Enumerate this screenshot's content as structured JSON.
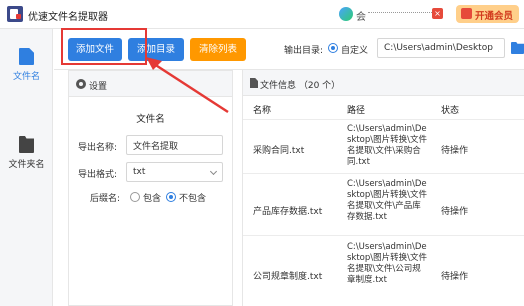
{
  "app": {
    "title": "优速文件名提取器"
  },
  "header": {
    "user_name": "会",
    "badge_text": "×",
    "vip_label": "开通会员"
  },
  "nav": {
    "items": [
      {
        "label": "文件名"
      },
      {
        "label": "文件夹名"
      }
    ]
  },
  "toolbar": {
    "add_file_label": "添加文件",
    "add_dir_label": "添加目录",
    "clear_label": "清除列表",
    "output_label": "输出目录:",
    "custom_label": "自定义",
    "output_path": "C:\\Users\\admin\\Desktop"
  },
  "settings": {
    "title": "设置",
    "section_title": "文件名",
    "export_name_label": "导出名称:",
    "export_name_value": "文件名提取",
    "export_format_label": "导出格式:",
    "export_format_value": "txt",
    "suffix_label": "后缀名:",
    "suffix_include": "包含",
    "suffix_exclude": "不包含"
  },
  "filelist": {
    "title": "文件信息 （20 个）",
    "columns": [
      "名称",
      "路径",
      "状态"
    ],
    "rows": [
      {
        "name": "采购合同.txt",
        "path": "C:\\Users\\admin\\Desktop\\图片转换\\文件名提取\\文件\\采购合同.txt",
        "status": "待操作"
      },
      {
        "name": "产品库存数据.txt",
        "path": "C:\\Users\\admin\\Desktop\\图片转换\\文件名提取\\文件\\产品库存数据.txt",
        "status": "待操作"
      },
      {
        "name": "公司规章制度.txt",
        "path": "C:\\Users\\admin\\Desktop\\图片转换\\文件名提取\\文件\\公司规章制度.txt",
        "status": "待操作"
      }
    ]
  },
  "colors": {
    "primary": "#2f7fe0",
    "orange": "#ff9800",
    "annotation": "#e53935",
    "vip_bg": "#ffcf8a"
  }
}
